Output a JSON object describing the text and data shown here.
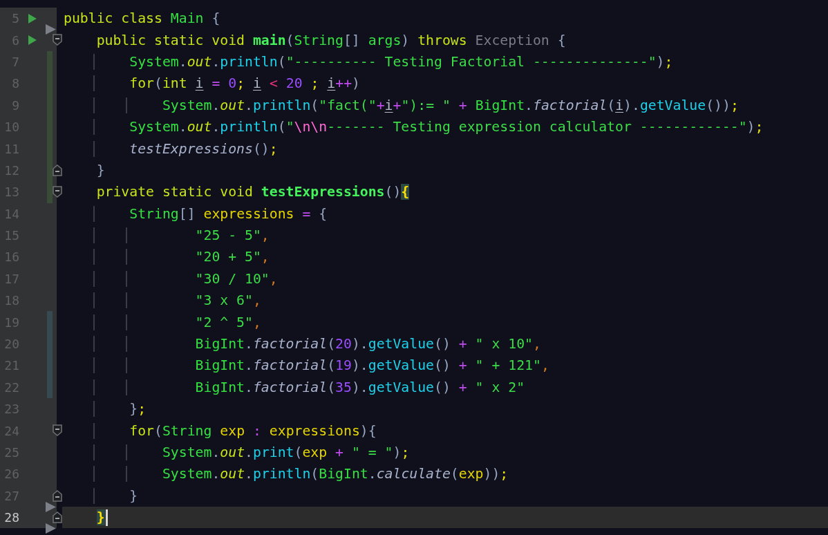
{
  "lines": [
    {
      "number": "5",
      "run": true,
      "marker": true,
      "current": false,
      "fold_start": false,
      "fold_end": false,
      "added": false,
      "modified": false,
      "tokens": [
        {
          "kind": "kw",
          "text": "public class "
        },
        {
          "kind": "type",
          "text": "Main"
        },
        {
          "kind": "punc",
          "text": " {"
        }
      ]
    },
    {
      "number": "6",
      "run": true,
      "marker": false,
      "current": false,
      "fold_start": true,
      "fold_end": false,
      "added": false,
      "modified": false,
      "tokens": [
        {
          "kind": "kw",
          "text": "    public static void "
        },
        {
          "kind": "decl",
          "text": "main"
        },
        {
          "kind": "punc",
          "text": "("
        },
        {
          "kind": "type",
          "text": "String"
        },
        {
          "kind": "punc",
          "text": "[]"
        },
        {
          "kind": "type",
          "text": " args"
        },
        {
          "kind": "punc",
          "text": ")"
        },
        {
          "kind": "kw",
          "text": " throws"
        },
        {
          "kind": "cls",
          "text": " Exception"
        },
        {
          "kind": "punc",
          "text": " {"
        }
      ]
    },
    {
      "number": "7",
      "run": false,
      "marker": false,
      "current": false,
      "fold_start": false,
      "fold_end": false,
      "added": true,
      "modified": false,
      "tokens": [
        {
          "kind": "type",
          "text": "        System"
        },
        {
          "kind": "punc",
          "text": "."
        },
        {
          "kind": "field",
          "text": "out"
        },
        {
          "kind": "punc",
          "text": "."
        },
        {
          "kind": "fn",
          "text": "println"
        },
        {
          "kind": "punc",
          "text": "("
        },
        {
          "kind": "str",
          "text": "\"---------- Testing Factorial --------------\""
        },
        {
          "kind": "punc",
          "text": ")"
        },
        {
          "kind": "semi",
          "text": ";"
        }
      ]
    },
    {
      "number": "8",
      "run": false,
      "marker": false,
      "current": false,
      "fold_start": false,
      "fold_end": false,
      "added": true,
      "modified": false,
      "tokens": [
        {
          "kind": "kw",
          "text": "        for"
        },
        {
          "kind": "punc",
          "text": "("
        },
        {
          "kind": "kw",
          "text": "int"
        },
        {
          "kind": "lv",
          "text": " i"
        },
        {
          "kind": "op",
          "text": " ="
        },
        {
          "kind": "num",
          "text": " 0"
        },
        {
          "kind": "semi",
          "text": ";"
        },
        {
          "kind": "lv",
          "text": " i"
        },
        {
          "kind": "lt",
          "text": " <"
        },
        {
          "kind": "num",
          "text": " 20"
        },
        {
          "kind": "semi",
          "text": " ;"
        },
        {
          "kind": "lv",
          "text": " i"
        },
        {
          "kind": "op",
          "text": "++"
        },
        {
          "kind": "punc",
          "text": ")"
        }
      ]
    },
    {
      "number": "9",
      "run": false,
      "marker": false,
      "current": false,
      "fold_start": false,
      "fold_end": false,
      "added": true,
      "modified": false,
      "tokens": [
        {
          "kind": "type",
          "text": "            System"
        },
        {
          "kind": "punc",
          "text": "."
        },
        {
          "kind": "field",
          "text": "out"
        },
        {
          "kind": "punc",
          "text": "."
        },
        {
          "kind": "fn",
          "text": "println"
        },
        {
          "kind": "punc",
          "text": "("
        },
        {
          "kind": "str",
          "text": "\"fact(\""
        },
        {
          "kind": "op",
          "text": "+"
        },
        {
          "kind": "lv",
          "text": "i"
        },
        {
          "kind": "op",
          "text": "+"
        },
        {
          "kind": "str",
          "text": "\"):= \""
        },
        {
          "kind": "op",
          "text": " +"
        },
        {
          "kind": "type",
          "text": " BigInt"
        },
        {
          "kind": "punc",
          "text": "."
        },
        {
          "kind": "scall",
          "text": "factorial"
        },
        {
          "kind": "punc",
          "text": "("
        },
        {
          "kind": "lv",
          "text": "i"
        },
        {
          "kind": "punc",
          "text": ")."
        },
        {
          "kind": "fn",
          "text": "getValue"
        },
        {
          "kind": "punc",
          "text": "())"
        },
        {
          "kind": "semi",
          "text": ";"
        }
      ]
    },
    {
      "number": "10",
      "run": false,
      "marker": false,
      "current": false,
      "fold_start": false,
      "fold_end": false,
      "added": true,
      "modified": false,
      "tokens": [
        {
          "kind": "type",
          "text": "        System"
        },
        {
          "kind": "punc",
          "text": "."
        },
        {
          "kind": "field",
          "text": "out"
        },
        {
          "kind": "punc",
          "text": "."
        },
        {
          "kind": "fn",
          "text": "println"
        },
        {
          "kind": "punc",
          "text": "("
        },
        {
          "kind": "str",
          "text": "\""
        },
        {
          "kind": "esc",
          "text": "\\n\\n"
        },
        {
          "kind": "str",
          "text": "------- Testing expression calculator ------------\""
        },
        {
          "kind": "punc",
          "text": ")"
        },
        {
          "kind": "semi",
          "text": ";"
        }
      ]
    },
    {
      "number": "11",
      "run": false,
      "marker": false,
      "current": false,
      "fold_start": false,
      "fold_end": false,
      "added": true,
      "modified": false,
      "tokens": [
        {
          "kind": "scall",
          "text": "        testExpressions"
        },
        {
          "kind": "punc",
          "text": "()"
        },
        {
          "kind": "semi",
          "text": ";"
        }
      ]
    },
    {
      "number": "12",
      "run": false,
      "marker": false,
      "current": false,
      "fold_start": false,
      "fold_end": true,
      "added": true,
      "modified": false,
      "tokens": [
        {
          "kind": "punc",
          "text": "    }"
        }
      ]
    },
    {
      "number": "13",
      "run": false,
      "marker": false,
      "current": false,
      "fold_start": true,
      "fold_end": false,
      "added": true,
      "modified": false,
      "tokens": [
        {
          "kind": "kw",
          "text": "    private static void "
        },
        {
          "kind": "decl",
          "text": "testExpressions"
        },
        {
          "kind": "punc",
          "text": "()"
        },
        {
          "kind": "match",
          "text": "{"
        }
      ]
    },
    {
      "number": "14",
      "run": false,
      "marker": false,
      "current": false,
      "fold_start": false,
      "fold_end": false,
      "added": false,
      "modified": false,
      "tokens": [
        {
          "kind": "type",
          "text": "        String"
        },
        {
          "kind": "punc",
          "text": "[]"
        },
        {
          "kind": "var",
          "text": " expressions"
        },
        {
          "kind": "op",
          "text": " ="
        },
        {
          "kind": "punc",
          "text": " {"
        }
      ]
    },
    {
      "number": "15",
      "run": false,
      "marker": false,
      "current": false,
      "fold_start": false,
      "fold_end": false,
      "added": false,
      "modified": false,
      "tokens": [
        {
          "kind": "str",
          "text": "                \"25 - 5\""
        },
        {
          "kind": "comma",
          "text": ","
        }
      ]
    },
    {
      "number": "16",
      "run": false,
      "marker": false,
      "current": false,
      "fold_start": false,
      "fold_end": false,
      "added": false,
      "modified": false,
      "tokens": [
        {
          "kind": "str",
          "text": "                \"20 + 5\""
        },
        {
          "kind": "comma",
          "text": ","
        }
      ]
    },
    {
      "number": "17",
      "run": false,
      "marker": false,
      "current": false,
      "fold_start": false,
      "fold_end": false,
      "added": false,
      "modified": false,
      "tokens": [
        {
          "kind": "str",
          "text": "                \"30 / 10\""
        },
        {
          "kind": "comma",
          "text": ","
        }
      ]
    },
    {
      "number": "18",
      "run": false,
      "marker": false,
      "current": false,
      "fold_start": false,
      "fold_end": false,
      "added": false,
      "modified": false,
      "tokens": [
        {
          "kind": "str",
          "text": "                \"3 x 6\""
        },
        {
          "kind": "comma",
          "text": ","
        }
      ]
    },
    {
      "number": "19",
      "run": false,
      "marker": false,
      "current": false,
      "fold_start": false,
      "fold_end": false,
      "added": false,
      "modified": true,
      "tokens": [
        {
          "kind": "str",
          "text": "                \"2 ^ 5\""
        },
        {
          "kind": "comma",
          "text": ","
        }
      ]
    },
    {
      "number": "20",
      "run": false,
      "marker": false,
      "current": false,
      "fold_start": false,
      "fold_end": false,
      "added": false,
      "modified": true,
      "tokens": [
        {
          "kind": "type",
          "text": "                BigInt"
        },
        {
          "kind": "punc",
          "text": "."
        },
        {
          "kind": "scall",
          "text": "factorial"
        },
        {
          "kind": "punc",
          "text": "("
        },
        {
          "kind": "num",
          "text": "20"
        },
        {
          "kind": "punc",
          "text": ")."
        },
        {
          "kind": "fn",
          "text": "getValue"
        },
        {
          "kind": "punc",
          "text": "()"
        },
        {
          "kind": "op",
          "text": " +"
        },
        {
          "kind": "str",
          "text": " \" x 10\""
        },
        {
          "kind": "comma",
          "text": ","
        }
      ]
    },
    {
      "number": "21",
      "run": false,
      "marker": false,
      "current": false,
      "fold_start": false,
      "fold_end": false,
      "added": false,
      "modified": true,
      "tokens": [
        {
          "kind": "type",
          "text": "                BigInt"
        },
        {
          "kind": "punc",
          "text": "."
        },
        {
          "kind": "scall",
          "text": "factorial"
        },
        {
          "kind": "punc",
          "text": "("
        },
        {
          "kind": "num",
          "text": "19"
        },
        {
          "kind": "punc",
          "text": ")."
        },
        {
          "kind": "fn",
          "text": "getValue"
        },
        {
          "kind": "punc",
          "text": "()"
        },
        {
          "kind": "op",
          "text": " +"
        },
        {
          "kind": "str",
          "text": " \" + 121\""
        },
        {
          "kind": "comma",
          "text": ","
        }
      ]
    },
    {
      "number": "22",
      "run": false,
      "marker": false,
      "current": false,
      "fold_start": false,
      "fold_end": false,
      "added": false,
      "modified": true,
      "tokens": [
        {
          "kind": "type",
          "text": "                BigInt"
        },
        {
          "kind": "punc",
          "text": "."
        },
        {
          "kind": "scall",
          "text": "factorial"
        },
        {
          "kind": "punc",
          "text": "("
        },
        {
          "kind": "num",
          "text": "35"
        },
        {
          "kind": "punc",
          "text": ")."
        },
        {
          "kind": "fn",
          "text": "getValue"
        },
        {
          "kind": "punc",
          "text": "()"
        },
        {
          "kind": "op",
          "text": " +"
        },
        {
          "kind": "str",
          "text": " \" x 2\""
        }
      ]
    },
    {
      "number": "23",
      "run": false,
      "marker": false,
      "current": false,
      "fold_start": false,
      "fold_end": false,
      "added": false,
      "modified": false,
      "tokens": [
        {
          "kind": "punc",
          "text": "        }"
        },
        {
          "kind": "semi",
          "text": ";"
        }
      ]
    },
    {
      "number": "24",
      "run": false,
      "marker": false,
      "current": false,
      "fold_start": true,
      "fold_end": false,
      "added": false,
      "modified": false,
      "tokens": [
        {
          "kind": "kw",
          "text": "        for"
        },
        {
          "kind": "punc",
          "text": "("
        },
        {
          "kind": "type",
          "text": "String"
        },
        {
          "kind": "var",
          "text": " exp"
        },
        {
          "kind": "op",
          "text": " :"
        },
        {
          "kind": "var",
          "text": " expressions"
        },
        {
          "kind": "punc",
          "text": "){"
        }
      ]
    },
    {
      "number": "25",
      "run": false,
      "marker": false,
      "current": false,
      "fold_start": false,
      "fold_end": false,
      "added": false,
      "modified": false,
      "tokens": [
        {
          "kind": "type",
          "text": "            System"
        },
        {
          "kind": "punc",
          "text": "."
        },
        {
          "kind": "field",
          "text": "out"
        },
        {
          "kind": "punc",
          "text": "."
        },
        {
          "kind": "fn",
          "text": "print"
        },
        {
          "kind": "punc",
          "text": "("
        },
        {
          "kind": "var",
          "text": "exp"
        },
        {
          "kind": "op",
          "text": " +"
        },
        {
          "kind": "str",
          "text": " \" = \""
        },
        {
          "kind": "punc",
          "text": ")"
        },
        {
          "kind": "semi",
          "text": ";"
        }
      ]
    },
    {
      "number": "26",
      "run": false,
      "marker": false,
      "current": false,
      "fold_start": false,
      "fold_end": false,
      "added": false,
      "modified": false,
      "tokens": [
        {
          "kind": "type",
          "text": "            System"
        },
        {
          "kind": "punc",
          "text": "."
        },
        {
          "kind": "field",
          "text": "out"
        },
        {
          "kind": "punc",
          "text": "."
        },
        {
          "kind": "fn",
          "text": "println"
        },
        {
          "kind": "punc",
          "text": "("
        },
        {
          "kind": "type",
          "text": "BigInt"
        },
        {
          "kind": "punc",
          "text": "."
        },
        {
          "kind": "scall",
          "text": "calculate"
        },
        {
          "kind": "punc",
          "text": "("
        },
        {
          "kind": "var",
          "text": "exp"
        },
        {
          "kind": "punc",
          "text": "))"
        },
        {
          "kind": "semi",
          "text": ";"
        }
      ]
    },
    {
      "number": "27",
      "run": false,
      "marker": true,
      "current": false,
      "fold_start": false,
      "fold_end": true,
      "added": false,
      "modified": false,
      "tokens": [
        {
          "kind": "punc",
          "text": "        }"
        }
      ]
    },
    {
      "number": "28",
      "run": false,
      "marker": true,
      "current": true,
      "fold_start": false,
      "fold_end": true,
      "added": false,
      "modified": false,
      "tokens": [
        {
          "kind": "match",
          "text": "    }"
        }
      ]
    }
  ]
}
